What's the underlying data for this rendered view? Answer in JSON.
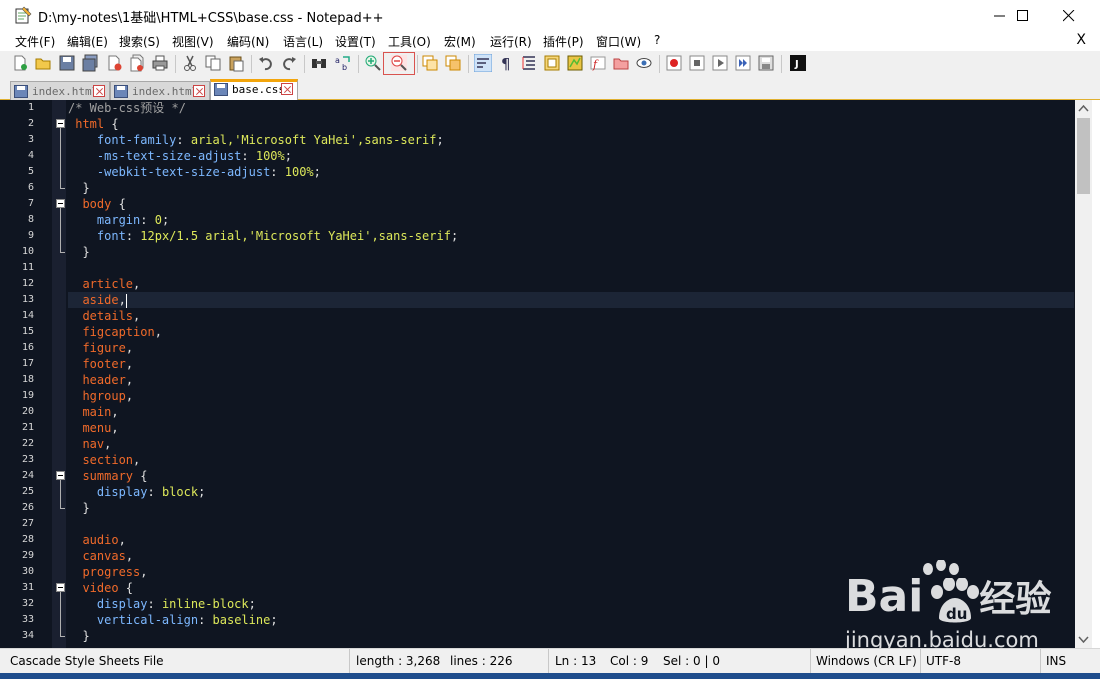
{
  "window": {
    "title": "D:\\my-notes\\1基础\\HTML+CSS\\base.css - Notepad++",
    "app_icon": "notepad-plus-plus-icon"
  },
  "menu": {
    "items": [
      "文件(F)",
      "编辑(E)",
      "搜索(S)",
      "视图(V)",
      "编码(N)",
      "语言(L)",
      "设置(T)",
      "工具(O)",
      "宏(M)",
      "运行(R)",
      "插件(P)",
      "窗口(W)",
      "?"
    ],
    "close_doc": "X"
  },
  "tabs": [
    {
      "label": "index.html",
      "active": false
    },
    {
      "label": "index.html",
      "active": false
    },
    {
      "label": "base.css",
      "active": true
    }
  ],
  "editor": {
    "current_line": 13,
    "lines": [
      {
        "n": "1",
        "tokens": [
          [
            "comment",
            "/* Web-css预设 */"
          ]
        ]
      },
      {
        "n": "2",
        "fold": true,
        "tokens": [
          [
            "plain",
            " "
          ],
          [
            "selector",
            "html"
          ],
          [
            "punct",
            " {"
          ]
        ]
      },
      {
        "n": "3",
        "tokens": [
          [
            "plain",
            "    "
          ],
          [
            "prop",
            "font-family"
          ],
          [
            "punct",
            ": "
          ],
          [
            "val",
            "arial,'Microsoft YaHei',sans-serif"
          ],
          [
            "punct",
            ";"
          ]
        ]
      },
      {
        "n": "4",
        "tokens": [
          [
            "plain",
            "    "
          ],
          [
            "prop",
            "-ms-text-size-adjust"
          ],
          [
            "punct",
            ": "
          ],
          [
            "val",
            "100%"
          ],
          [
            "punct",
            ";"
          ]
        ]
      },
      {
        "n": "5",
        "tokens": [
          [
            "plain",
            "    "
          ],
          [
            "prop",
            "-webkit-text-size-adjust"
          ],
          [
            "punct",
            ": "
          ],
          [
            "val",
            "100%"
          ],
          [
            "punct",
            ";"
          ]
        ]
      },
      {
        "n": "6",
        "tokens": [
          [
            "plain",
            "  "
          ],
          [
            "punct",
            "}"
          ]
        ]
      },
      {
        "n": "7",
        "fold": true,
        "tokens": [
          [
            "plain",
            "  "
          ],
          [
            "selector",
            "body"
          ],
          [
            "punct",
            " {"
          ]
        ]
      },
      {
        "n": "8",
        "tokens": [
          [
            "plain",
            "    "
          ],
          [
            "prop",
            "margin"
          ],
          [
            "punct",
            ": "
          ],
          [
            "val",
            "0"
          ],
          [
            "punct",
            ";"
          ]
        ]
      },
      {
        "n": "9",
        "tokens": [
          [
            "plain",
            "    "
          ],
          [
            "prop",
            "font"
          ],
          [
            "punct",
            ": "
          ],
          [
            "val",
            "12px/1.5 arial,'Microsoft YaHei',sans-serif"
          ],
          [
            "punct",
            ";"
          ]
        ]
      },
      {
        "n": "10",
        "tokens": [
          [
            "plain",
            "  "
          ],
          [
            "punct",
            "}"
          ]
        ]
      },
      {
        "n": "11",
        "tokens": []
      },
      {
        "n": "12",
        "tokens": [
          [
            "plain",
            "  "
          ],
          [
            "selector",
            "article"
          ],
          [
            "punct",
            ","
          ]
        ]
      },
      {
        "n": "13",
        "tokens": [
          [
            "plain",
            "  "
          ],
          [
            "selector",
            "aside"
          ],
          [
            "punct",
            ","
          ]
        ]
      },
      {
        "n": "14",
        "tokens": [
          [
            "plain",
            "  "
          ],
          [
            "selector",
            "details"
          ],
          [
            "punct",
            ","
          ]
        ]
      },
      {
        "n": "15",
        "tokens": [
          [
            "plain",
            "  "
          ],
          [
            "selector",
            "figcaption"
          ],
          [
            "punct",
            ","
          ]
        ]
      },
      {
        "n": "16",
        "tokens": [
          [
            "plain",
            "  "
          ],
          [
            "selector",
            "figure"
          ],
          [
            "punct",
            ","
          ]
        ]
      },
      {
        "n": "17",
        "tokens": [
          [
            "plain",
            "  "
          ],
          [
            "selector",
            "footer"
          ],
          [
            "punct",
            ","
          ]
        ]
      },
      {
        "n": "18",
        "tokens": [
          [
            "plain",
            "  "
          ],
          [
            "selector",
            "header"
          ],
          [
            "punct",
            ","
          ]
        ]
      },
      {
        "n": "19",
        "tokens": [
          [
            "plain",
            "  "
          ],
          [
            "selector",
            "hgroup"
          ],
          [
            "punct",
            ","
          ]
        ]
      },
      {
        "n": "20",
        "tokens": [
          [
            "plain",
            "  "
          ],
          [
            "selector",
            "main"
          ],
          [
            "punct",
            ","
          ]
        ]
      },
      {
        "n": "21",
        "tokens": [
          [
            "plain",
            "  "
          ],
          [
            "selector",
            "menu"
          ],
          [
            "punct",
            ","
          ]
        ]
      },
      {
        "n": "22",
        "tokens": [
          [
            "plain",
            "  "
          ],
          [
            "selector",
            "nav"
          ],
          [
            "punct",
            ","
          ]
        ]
      },
      {
        "n": "23",
        "tokens": [
          [
            "plain",
            "  "
          ],
          [
            "selector",
            "section"
          ],
          [
            "punct",
            ","
          ]
        ]
      },
      {
        "n": "24",
        "fold": true,
        "tokens": [
          [
            "plain",
            "  "
          ],
          [
            "selector",
            "summary"
          ],
          [
            "punct",
            " {"
          ]
        ]
      },
      {
        "n": "25",
        "tokens": [
          [
            "plain",
            "    "
          ],
          [
            "prop",
            "display"
          ],
          [
            "punct",
            ": "
          ],
          [
            "val",
            "block"
          ],
          [
            "punct",
            ";"
          ]
        ]
      },
      {
        "n": "26",
        "tokens": [
          [
            "plain",
            "  "
          ],
          [
            "punct",
            "}"
          ]
        ]
      },
      {
        "n": "27",
        "tokens": []
      },
      {
        "n": "28",
        "tokens": [
          [
            "plain",
            "  "
          ],
          [
            "selector",
            "audio"
          ],
          [
            "punct",
            ","
          ]
        ]
      },
      {
        "n": "29",
        "tokens": [
          [
            "plain",
            "  "
          ],
          [
            "selector",
            "canvas"
          ],
          [
            "punct",
            ","
          ]
        ]
      },
      {
        "n": "30",
        "tokens": [
          [
            "plain",
            "  "
          ],
          [
            "selector",
            "progress"
          ],
          [
            "punct",
            ","
          ]
        ]
      },
      {
        "n": "31",
        "fold": true,
        "tokens": [
          [
            "plain",
            "  "
          ],
          [
            "selector",
            "video"
          ],
          [
            "punct",
            " {"
          ]
        ]
      },
      {
        "n": "32",
        "tokens": [
          [
            "plain",
            "    "
          ],
          [
            "prop",
            "display"
          ],
          [
            "punct",
            ": "
          ],
          [
            "val",
            "inline-block"
          ],
          [
            "punct",
            ";"
          ]
        ]
      },
      {
        "n": "33",
        "tokens": [
          [
            "plain",
            "    "
          ],
          [
            "prop",
            "vertical-align"
          ],
          [
            "punct",
            ": "
          ],
          [
            "val",
            "baseline"
          ],
          [
            "punct",
            ";"
          ]
        ]
      },
      {
        "n": "34",
        "tokens": [
          [
            "plain",
            "  "
          ],
          [
            "punct",
            "}"
          ]
        ]
      }
    ]
  },
  "status": {
    "file_type": "Cascade Style Sheets File",
    "length": "length : 3,268",
    "lines": "lines : 226",
    "ln": "Ln : 13",
    "col": "Col : 9",
    "sel": "Sel : 0 | 0",
    "eol": "Windows (CR LF)",
    "encoding": "UTF-8",
    "mode": "INS"
  },
  "watermark": {
    "brand": "Bai",
    "brand_cn": "经验",
    "url": "jingyan.baidu.com"
  },
  "colors": {
    "editor_bg": "#0f1521",
    "selector": "#f06a2a",
    "property": "#7db8ff",
    "value": "#dde85a",
    "comment": "#a0a0a0",
    "active_tab_accent": "#f3a50b"
  }
}
